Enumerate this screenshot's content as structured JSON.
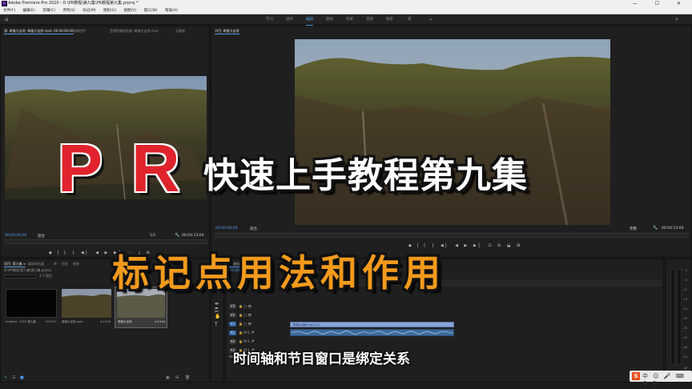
{
  "app": {
    "title": "Adobe Premiere Pro 2020 - D:\\PR教程\\第九集\\PR教程第九集.prproj *",
    "window_controls": "— ☐ ✕"
  },
  "menu": [
    "文件(F)",
    "编辑(E)",
    "剪辑(C)",
    "序列(S)",
    "标记(M)",
    "图形(G)",
    "视图(V)",
    "窗口(W)",
    "帮助(H)"
  ],
  "workspaces": {
    "tabs": [
      "学习",
      "组件",
      "编辑",
      "颜色",
      "效果",
      "音频",
      "图形",
      "库"
    ],
    "active": "编辑",
    "more": "»"
  },
  "source_panel": {
    "tabs": [
      "源: 希腊大自然: 希腊大自然.mp4: 00:00:00:00",
      "效果控件",
      "音频剪辑混合器: 希腊大自然.mp4",
      "元数据"
    ],
    "timecode": "00;00;00;00",
    "fit": "适合",
    "scale": "1/2",
    "duration": "00:04:13:04",
    "controls": "◆ ▏{ } ◀▏ ◀ ▶ ▶▏ ⋯ ⤓ ⊞"
  },
  "program_panel": {
    "tab": "节目: 希腊大自然",
    "timecode": "00;00;00;00",
    "fit": "适合",
    "scale": "完整",
    "duration": "00:04:13:04",
    "controls": "◆ ▏{ } ◀▏ ◀ ▶ ▶▏ ⊡ ⊟ ⬓ ⊞"
  },
  "project_panel": {
    "tabs": [
      "项目: 第九集 ≡",
      "媒体浏览器",
      "库",
      "信息",
      "效果"
    ],
    "path": "D:\\PR教程\\第九集\\第九集.prproj",
    "count": "3 个项目",
    "items": [
      {
        "name": "Untitled - 2019 第九集",
        "duration": "5:20:27"
      },
      {
        "name": "希腊大自然.mp4",
        "duration": "4:13:04"
      },
      {
        "name": "希腊大自然",
        "duration": "4:13:04"
      }
    ]
  },
  "timeline_panel": {
    "tab": "希腊大自然 ≡",
    "timecode": "00;00;00;00",
    "tracks": [
      {
        "name": "V3",
        "label": "视频 3"
      },
      {
        "name": "V2",
        "label": "视频 2"
      },
      {
        "name": "V1",
        "label": "视频 1"
      },
      {
        "name": "A1",
        "label": "音频 1"
      },
      {
        "name": "A2",
        "label": "音频 2"
      },
      {
        "name": "A3",
        "label": "音频 3"
      }
    ],
    "clip_name": "希腊大自然.mp4 [V]",
    "meter_scale": [
      "0",
      "-6",
      "-12",
      "-18",
      "-24",
      "-30",
      "-36",
      "-42",
      "-48",
      "-54",
      "dB"
    ]
  },
  "overlay": {
    "big_title": "PR",
    "subtitle1": "快速上手教程第九集",
    "subtitle2": "标记点用法和作用",
    "caption": "时间轴和节目窗口是绑定关系"
  },
  "taskbar": {
    "ime": "S",
    "icons": "中 ☺ 🎤 ⌨ ⚙ ⊞"
  },
  "colors": {
    "accent": "#4d9ae8",
    "title_red": "#e0232d",
    "subtitle_orange": "#f39a1c",
    "clip_blue": "#8aa3d6"
  }
}
